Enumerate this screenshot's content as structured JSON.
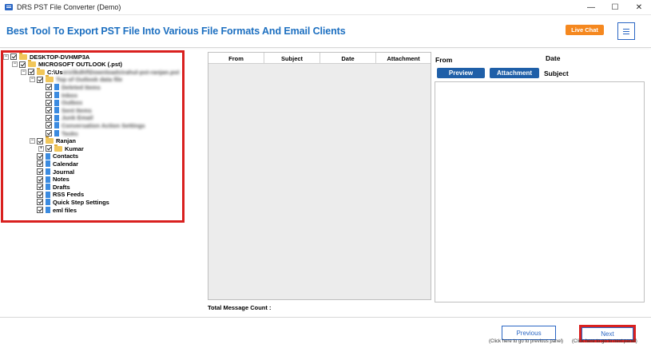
{
  "window": {
    "title": "DRS PST File Converter (Demo)",
    "minimize": "—",
    "maximize": "☐",
    "close": "✕"
  },
  "header": {
    "title": "Best Tool To Export PST File Into Various File Formats And Email Clients",
    "live_chat": "Live Chat",
    "menu_icon": "hamburger-icon"
  },
  "tree": {
    "items": [
      {
        "label": "DESKTOP-DVHMP3A",
        "icon": "folder-icon",
        "level": 0,
        "expander": "−"
      },
      {
        "label": "MICROSOFT OUTLOOK (.pst)",
        "icon": "folder-icon",
        "level": 1,
        "expander": "−"
      },
      {
        "label": "C:\\Users\\lkdhf\\Downloads\\rahul-pst-ranjan.pst",
        "icon": "folder-icon",
        "level": 2,
        "expander": "−",
        "blurred": true,
        "prefix": "C:\\Us"
      },
      {
        "label": "Top of Outlook data file",
        "icon": "folder-icon",
        "level": 3,
        "expander": "−",
        "blurred": true
      },
      {
        "label": "Deleted Items",
        "icon": "doc-icon",
        "level": 4,
        "blurred": true
      },
      {
        "label": "Inbox",
        "icon": "doc-icon",
        "level": 4,
        "blurred": true
      },
      {
        "label": "Outbox",
        "icon": "doc-icon",
        "level": 4,
        "blurred": true
      },
      {
        "label": "Sent Items",
        "icon": "doc-icon",
        "level": 4,
        "blurred": true
      },
      {
        "label": "Junk Email",
        "icon": "doc-icon",
        "level": 4,
        "blurred": true
      },
      {
        "label": "Conversation Action Settings",
        "icon": "doc-icon",
        "level": 4,
        "blurred": true
      },
      {
        "label": "Tasks",
        "icon": "doc-icon",
        "level": 4,
        "blurred": true
      },
      {
        "label": "Ranjan",
        "icon": "folder-icon",
        "level": 3,
        "expander": "−"
      },
      {
        "label": "Kumar",
        "icon": "folder-icon",
        "level": 4,
        "expander": "+"
      },
      {
        "label": "Contacts",
        "icon": "doc-icon",
        "level": 3
      },
      {
        "label": "Calendar",
        "icon": "doc-icon",
        "level": 3
      },
      {
        "label": "Journal",
        "icon": "doc-icon",
        "level": 3
      },
      {
        "label": "Notes",
        "icon": "doc-icon",
        "level": 3
      },
      {
        "label": "Drafts",
        "icon": "doc-icon",
        "level": 3
      },
      {
        "label": "RSS Feeds",
        "icon": "doc-icon",
        "level": 3
      },
      {
        "label": "Quick Step Settings",
        "icon": "doc-icon",
        "level": 3
      },
      {
        "label": "eml files",
        "icon": "doc-icon",
        "level": 3
      }
    ]
  },
  "messages": {
    "columns": [
      "From",
      "Subject",
      "Date",
      "Attachment"
    ],
    "total_label": "Total Message Count :"
  },
  "preview": {
    "from_label": "From",
    "date_label": "Date",
    "preview_button": "Preview",
    "attachment_button": "Attachment",
    "subject_label": "Subject"
  },
  "footer": {
    "previous": "Previous",
    "next": "Next",
    "previous_hint": "(Click here to go to previous panel)",
    "next_hint": "(Click here to go to next panel)"
  },
  "colors": {
    "accent": "#1c6fc0",
    "live_chat": "#f5881f",
    "highlight": "#d9201f",
    "button": "#1f5fa8"
  }
}
